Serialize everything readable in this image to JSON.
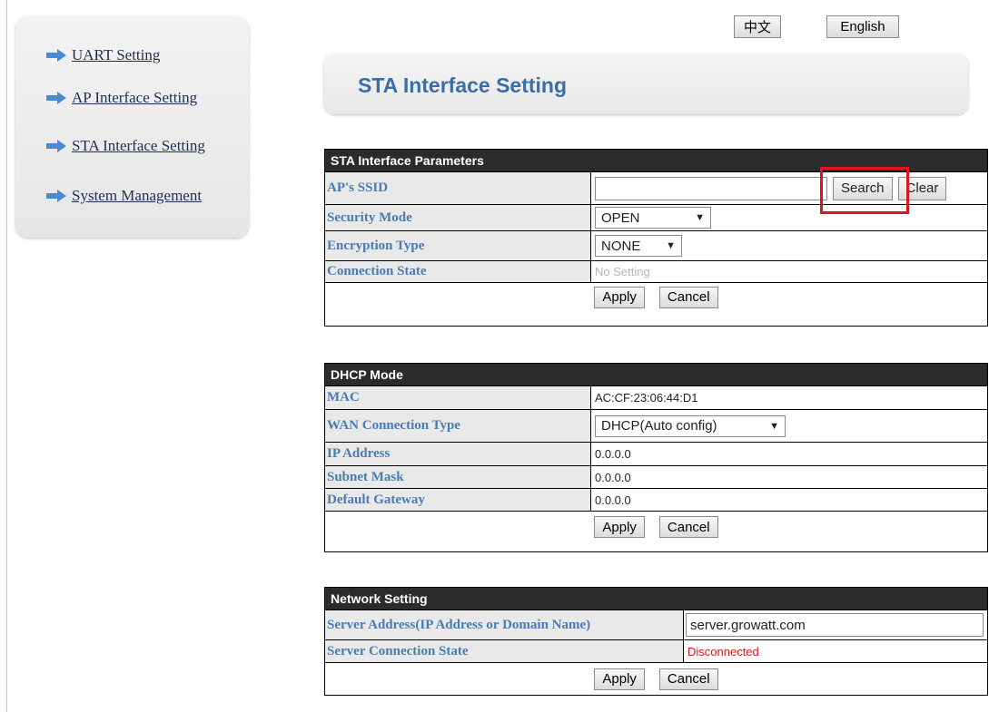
{
  "language": {
    "chinese_label": "中文",
    "english_label": "English"
  },
  "sidebar": {
    "items": [
      {
        "label": "UART Setting",
        "icon": "arrow-right-icon"
      },
      {
        "label": "AP Interface Setting",
        "icon": "arrow-right-icon"
      },
      {
        "label": "STA Interface Setting",
        "icon": "arrow-right-icon"
      },
      {
        "label": "System Management",
        "icon": "arrow-right-icon"
      }
    ]
  },
  "page": {
    "title": "STA Interface Setting"
  },
  "sta_params": {
    "header": "STA Interface Parameters",
    "ssid_label": "AP's SSID",
    "ssid_value": "",
    "search_label": "Search",
    "clear_label": "Clear",
    "security_label": "Security Mode",
    "security_value": "OPEN",
    "encryption_label": "Encryption Type",
    "encryption_value": "NONE",
    "conn_state_label": "Connection State",
    "conn_state_value": "No Setting",
    "apply_label": "Apply",
    "cancel_label": "Cancel"
  },
  "dhcp": {
    "header": "DHCP Mode",
    "mac_label": "MAC",
    "mac_value": "AC:CF:23:06:44:D1",
    "wan_label": "WAN Connection Type",
    "wan_value": "DHCP(Auto config)",
    "ip_label": "IP Address",
    "ip_value": "0.0.0.0",
    "subnet_label": "Subnet Mask",
    "subnet_value": "0.0.0.0",
    "gateway_label": "Default Gateway",
    "gateway_value": "0.0.0.0",
    "apply_label": "Apply",
    "cancel_label": "Cancel"
  },
  "network": {
    "header": "Network Setting",
    "server_label": "Server Address(IP Address or Domain Name)",
    "server_value": "server.growatt.com",
    "server_state_label": "Server Connection State",
    "server_state_value": "Disconnected",
    "apply_label": "Apply",
    "cancel_label": "Cancel"
  },
  "colors": {
    "link": "#1f2f4f",
    "title": "#3a6ea5",
    "key_text": "#4a7bb1",
    "header_bg": "#2b2b2b",
    "highlight": "#e0141e",
    "disconnected": "#d01818"
  }
}
